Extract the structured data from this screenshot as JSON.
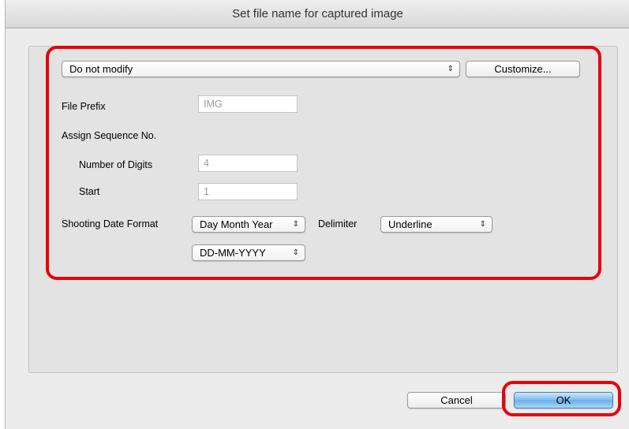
{
  "dialog": {
    "title": "Set file name for captured image"
  },
  "form": {
    "naming_select": "Do not modify",
    "customize_button": "Customize...",
    "file_prefix_label": "File Prefix",
    "file_prefix_value": "IMG",
    "sequence_label": "Assign Sequence No.",
    "digits_label": "Number of Digits",
    "digits_value": "4",
    "start_label": "Start",
    "start_value": "1",
    "date_format_label": "Shooting Date Format",
    "date_format_select": "Day Month Year",
    "delimiter_label": "Delimiter",
    "delimiter_select": "Underline",
    "date_pattern_select": "DD-MM-YYYY"
  },
  "buttons": {
    "cancel": "Cancel",
    "ok": "OK"
  },
  "colors": {
    "highlight": "#e8000b",
    "ok_button": "#79b9ef"
  }
}
